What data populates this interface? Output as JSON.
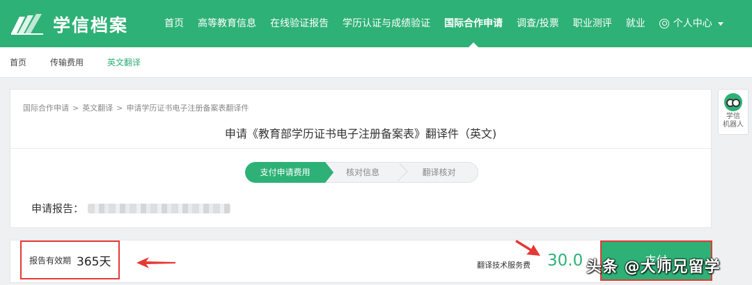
{
  "header": {
    "logo_text": "学信档案",
    "nav": [
      {
        "label": "首页"
      },
      {
        "label": "高等教育信息"
      },
      {
        "label": "在线验证报告"
      },
      {
        "label": "学历认证与成绩验证"
      },
      {
        "label": "国际合作申请",
        "active": true
      },
      {
        "label": "调查/投票"
      },
      {
        "label": "职业测评"
      },
      {
        "label": "就业"
      }
    ],
    "user_label": "个人中心"
  },
  "subnav": {
    "items": [
      {
        "label": "首页"
      },
      {
        "label": "传输费用"
      },
      {
        "label": "英文翻译",
        "active": true
      }
    ]
  },
  "main": {
    "breadcrumb": [
      "国际合作申请",
      "英文翻译",
      "申请学历证书电子注册备案表翻译件"
    ],
    "breadcrumb_sep": ">",
    "title": "申请《教育部学历证书电子注册备案表》翻译件（英文)",
    "steps": [
      "支付申请费用",
      "核对信息",
      "翻译核对"
    ],
    "report_label": "申请报告："
  },
  "bottom": {
    "validity_label": "报告有效期",
    "validity_value": "365天",
    "fee_label": "翻译技术服务费",
    "fee_value": "30.0",
    "pay_label": "支付"
  },
  "robot": {
    "label_line1": "学信",
    "label_line2": "机器人"
  },
  "watermark": "头条 @大师兄留学",
  "colors": {
    "brand": "#2eb176",
    "annotation": "#e53935"
  }
}
